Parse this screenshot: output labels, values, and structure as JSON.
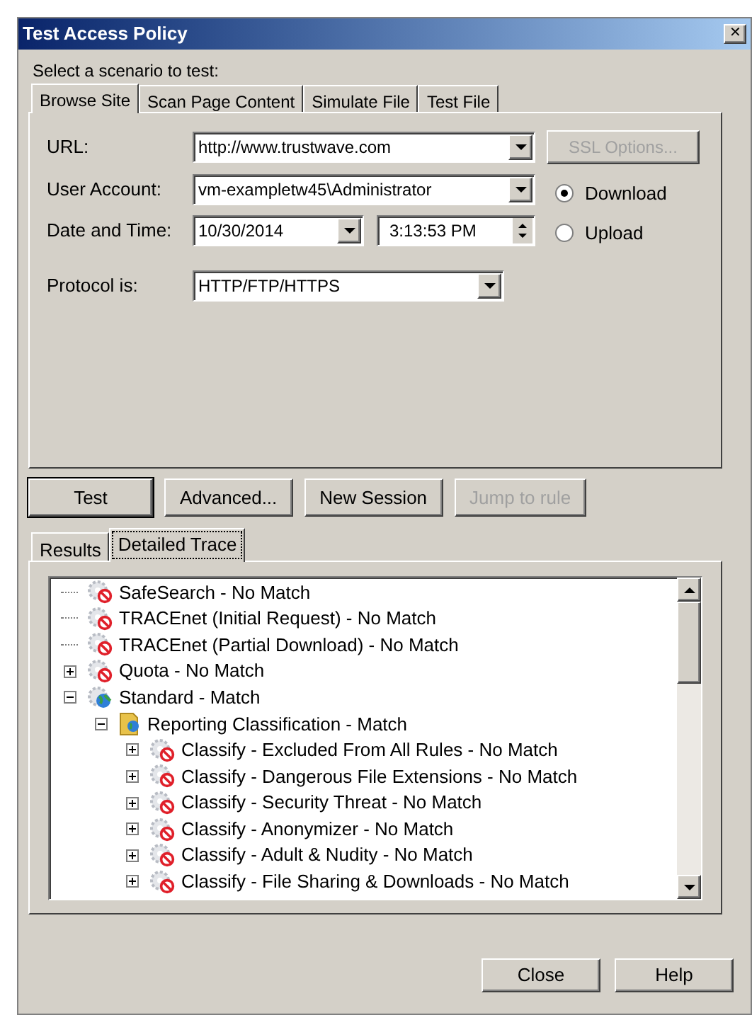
{
  "window": {
    "title": "Test Access Policy",
    "close": "✕"
  },
  "scenario_label": "Select a scenario to test:",
  "tabs": [
    {
      "label": "Browse Site",
      "selected": true
    },
    {
      "label": "Scan Page Content",
      "selected": false
    },
    {
      "label": "Simulate File",
      "selected": false
    },
    {
      "label": "Test File",
      "selected": false
    }
  ],
  "form": {
    "url": {
      "label": "URL:",
      "value": "http://www.trustwave.com"
    },
    "ssl_button": {
      "label": "SSL Options...",
      "disabled": true
    },
    "user_account": {
      "label": "User Account:",
      "value": "vm-exampletw45\\Administrator"
    },
    "date_time": {
      "label": "Date and Time:",
      "date": "10/30/2014",
      "time": "3:13:53 PM"
    },
    "direction": [
      {
        "label": "Download",
        "selected": true
      },
      {
        "label": "Upload",
        "selected": false
      }
    ],
    "protocol": {
      "label": "Protocol is:",
      "value": "HTTP/FTP/HTTPS"
    }
  },
  "actions": [
    {
      "label": "Test",
      "disabled": false,
      "default": true
    },
    {
      "label": "Advanced...",
      "disabled": false,
      "default": false
    },
    {
      "label": "New Session",
      "disabled": false,
      "default": false
    },
    {
      "label": "Jump to rule",
      "disabled": true,
      "default": false
    }
  ],
  "result_tabs": [
    {
      "label": "Results",
      "selected": false
    },
    {
      "label": "Detailed Trace",
      "selected": true
    }
  ],
  "trace": [
    {
      "label": "SafeSearch - No Match",
      "kind": "no_match"
    },
    {
      "label": "TRACEnet (Initial Request) - No Match",
      "kind": "no_match"
    },
    {
      "label": "TRACEnet (Partial Download) - No Match",
      "kind": "no_match"
    },
    {
      "label": "Quota - No Match",
      "kind": "no_match",
      "expanded": false
    },
    {
      "label": "Standard - Match",
      "kind": "match",
      "expanded": true,
      "children": [
        {
          "label": "Reporting Classification - Match",
          "kind": "folder",
          "expanded": true,
          "children": [
            {
              "label": "Classify - Excluded From All Rules - No Match",
              "kind": "no_match",
              "expanded": false
            },
            {
              "label": "Classify - Dangerous File Extensions - No Match",
              "kind": "no_match",
              "expanded": false
            },
            {
              "label": "Classify - Security Threat - No Match",
              "kind": "no_match",
              "expanded": false
            },
            {
              "label": "Classify - Anonymizer - No Match",
              "kind": "no_match",
              "expanded": false
            },
            {
              "label": "Classify - Adult & Nudity - No Match",
              "kind": "no_match",
              "expanded": false
            },
            {
              "label": "Classify - File Sharing & Downloads - No Match",
              "kind": "no_match",
              "expanded": false
            }
          ]
        }
      ]
    }
  ],
  "footer": [
    {
      "label": "Close"
    },
    {
      "label": "Help"
    }
  ]
}
